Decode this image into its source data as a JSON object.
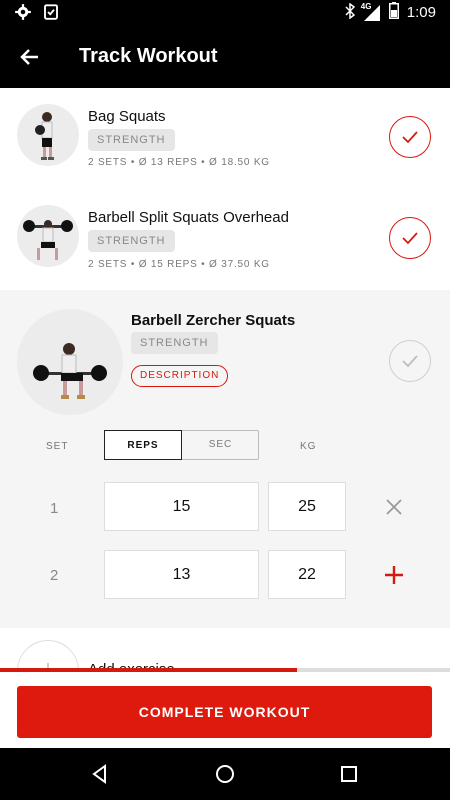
{
  "status_bar": {
    "time": "1:09",
    "network": "4G"
  },
  "header": {
    "title": "Track Workout"
  },
  "exercises": [
    {
      "name": "Bag Squats",
      "category": "STRENGTH",
      "stats": "2 SETS • Ø 13 REPS • Ø 18.50 KG",
      "completed": true
    },
    {
      "name": "Barbell Split Squats Overhead",
      "category": "STRENGTH",
      "stats": "2 SETS • Ø 15 REPS • Ø 37.50 KG",
      "completed": true
    }
  ],
  "active_exercise": {
    "name": "Barbell Zercher Squats",
    "category": "STRENGTH",
    "description_label": "DESCRIPTION",
    "completed": false,
    "columns": {
      "set": "SET",
      "reps": "REPS",
      "sec": "SEC",
      "kg": "KG"
    },
    "selected_mode": "REPS",
    "sets": [
      {
        "set": "1",
        "reps": "15",
        "kg": "25",
        "action": "remove"
      },
      {
        "set": "2",
        "reps": "13",
        "kg": "22",
        "action": "add"
      }
    ]
  },
  "add_exercise": {
    "label": "Add exercise"
  },
  "progress": {
    "fraction": 0.66
  },
  "footer": {
    "complete_label": "COMPLETE WORKOUT"
  },
  "colors": {
    "accent": "#d41a0f",
    "button": "#dd1a0d"
  }
}
